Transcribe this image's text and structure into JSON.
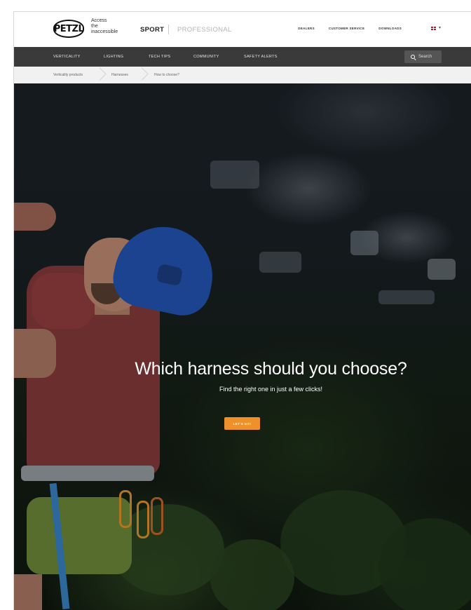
{
  "header": {
    "logo_text": "PETZL",
    "tagline": [
      "Access",
      "the",
      "inaccessible"
    ],
    "universe_sport": "SPORT",
    "universe_professional": "PROFESSIONAL",
    "links": [
      "DEALERS",
      "CUSTOMER SERVICE",
      "DOWNLOADS"
    ],
    "flag_icon": "uk-flag-icon"
  },
  "nav": {
    "items": [
      "VERTICALITY",
      "LIGHTING",
      "TECH TIPS",
      "COMMUNITY",
      "SAFETY ALERTS"
    ],
    "search_label": "Search"
  },
  "breadcrumb": [
    "Verticality products",
    "Harnesses",
    "How to choose?"
  ],
  "hero": {
    "title": "Which harness should you choose?",
    "subtitle": "Find the right one in just a few clicks!",
    "cta_label": "LET'S GO!"
  },
  "colors": {
    "nav_bg": "#3a3a3a",
    "cta": "#f0902a",
    "breadcrumb_bg": "#f1f1f1"
  }
}
